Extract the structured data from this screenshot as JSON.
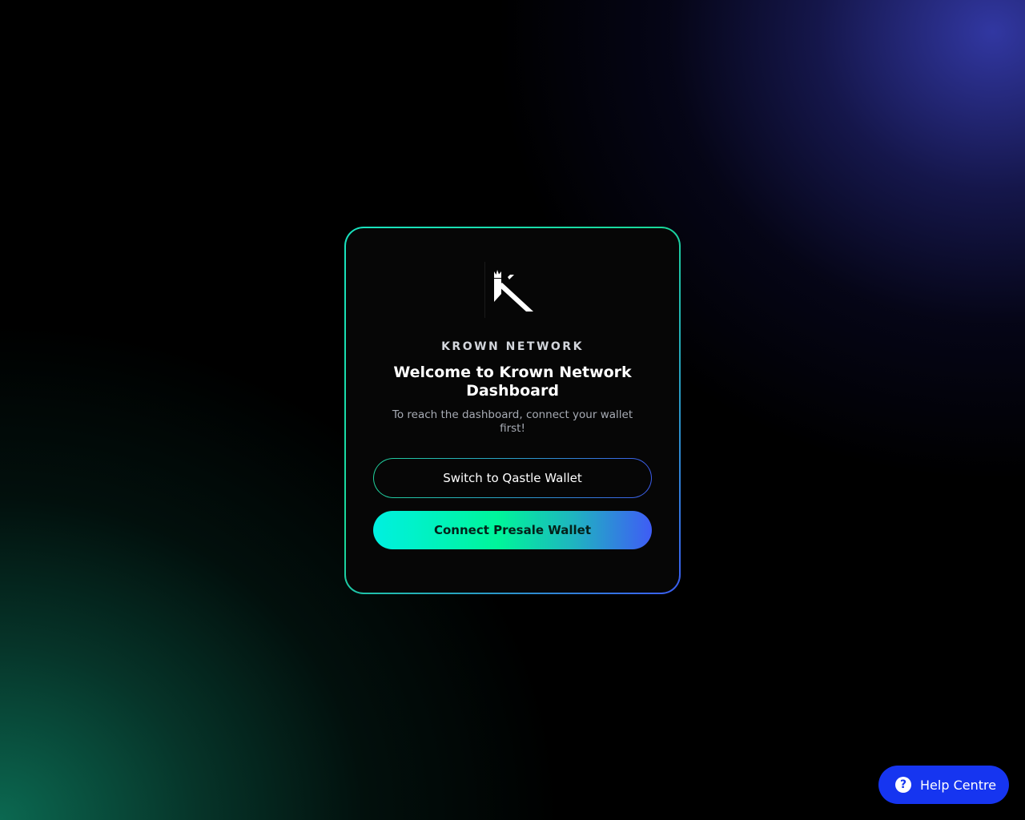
{
  "card": {
    "logo_icon": "krown-k-logo-icon",
    "brand": "KROWN NETWORK",
    "title": "Welcome to Krown Network Dashboard",
    "subtitle": "To reach the dashboard, connect your wallet first!",
    "switch_button_label": "Switch to Qastle Wallet",
    "connect_button_label": "Connect Presale Wallet"
  },
  "help": {
    "icon": "question-circle-icon",
    "icon_glyph": "?",
    "label": "Help Centre"
  },
  "colors": {
    "accent_green": "#00f59a",
    "accent_cyan": "#00f0e0",
    "accent_blue": "#3f5cf5",
    "help_blue": "#1635f0",
    "card_bg": "#060606"
  }
}
